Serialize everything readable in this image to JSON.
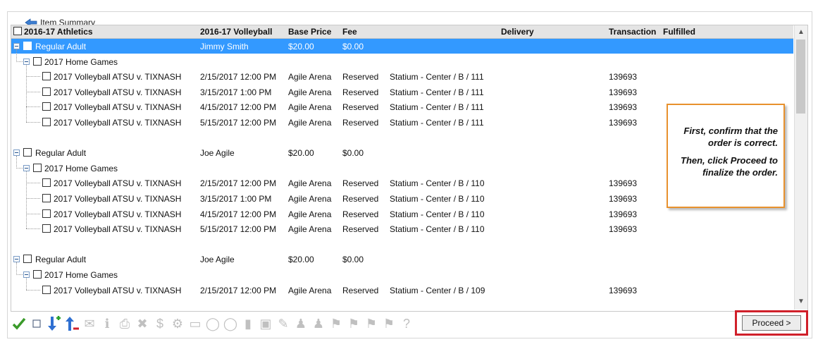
{
  "panel": {
    "title": "Item Summary"
  },
  "columns": {
    "event": "2016-17 Athletics",
    "patron": "2016-17 Volleyball",
    "base_price": "Base Price",
    "fee": "Fee",
    "delivery": "Delivery",
    "transaction": "Transaction",
    "fulfilled": "Fulfilled"
  },
  "groups": [
    {
      "label": "Regular Adult",
      "patron": "Jimmy Smith",
      "price": "$20.00",
      "fee": "$0.00",
      "selected": true,
      "subgroup": "2017 Home Games",
      "items": [
        {
          "name": "2017 Volleyball ATSU v. TIXNASH",
          "date": "2/15/2017 12:00 PM",
          "venue": "Agile Arena",
          "type": "Reserved",
          "seat": "Statium - Center / B / 111",
          "transaction": "139693"
        },
        {
          "name": "2017 Volleyball ATSU v. TIXNASH",
          "date": "3/15/2017 1:00 PM",
          "venue": "Agile Arena",
          "type": "Reserved",
          "seat": "Statium - Center / B / 111",
          "transaction": "139693"
        },
        {
          "name": "2017 Volleyball ATSU v. TIXNASH",
          "date": "4/15/2017 12:00 PM",
          "venue": "Agile Arena",
          "type": "Reserved",
          "seat": "Statium - Center / B / 111",
          "transaction": "139693"
        },
        {
          "name": "2017 Volleyball ATSU v. TIXNASH",
          "date": "5/15/2017 12:00 PM",
          "venue": "Agile Arena",
          "type": "Reserved",
          "seat": "Statium - Center / B / 111",
          "transaction": "139693"
        }
      ]
    },
    {
      "label": "Regular Adult",
      "patron": "Joe Agile",
      "price": "$20.00",
      "fee": "$0.00",
      "selected": false,
      "subgroup": "2017 Home Games",
      "items": [
        {
          "name": "2017 Volleyball ATSU v. TIXNASH",
          "date": "2/15/2017 12:00 PM",
          "venue": "Agile Arena",
          "type": "Reserved",
          "seat": "Statium - Center / B / 110",
          "transaction": "139693"
        },
        {
          "name": "2017 Volleyball ATSU v. TIXNASH",
          "date": "3/15/2017 1:00 PM",
          "venue": "Agile Arena",
          "type": "Reserved",
          "seat": "Statium - Center / B / 110",
          "transaction": "139693"
        },
        {
          "name": "2017 Volleyball ATSU v. TIXNASH",
          "date": "4/15/2017 12:00 PM",
          "venue": "Agile Arena",
          "type": "Reserved",
          "seat": "Statium - Center / B / 110",
          "transaction": "139693"
        },
        {
          "name": "2017 Volleyball ATSU v. TIXNASH",
          "date": "5/15/2017 12:00 PM",
          "venue": "Agile Arena",
          "type": "Reserved",
          "seat": "Statium - Center / B / 110",
          "transaction": "139693"
        }
      ]
    },
    {
      "label": "Regular Adult",
      "patron": "Joe Agile",
      "price": "$20.00",
      "fee": "$0.00",
      "selected": false,
      "subgroup": "2017 Home Games",
      "items": [
        {
          "name": "2017 Volleyball ATSU v. TIXNASH",
          "date": "2/15/2017 12:00 PM",
          "venue": "Agile Arena",
          "type": "Reserved",
          "seat": "Statium - Center / B / 109",
          "transaction": "139693"
        }
      ]
    }
  ],
  "callout": {
    "line1": "First, confirm that the order is correct.",
    "line2": "Then, click Proceed to finalize the order."
  },
  "toolbar": {
    "icons": [
      "check-all-icon",
      "uncheck-all-icon",
      "move-down-icon",
      "move-up-icon",
      "mail-icon",
      "info-icon",
      "print-icon",
      "delete-icon",
      "price-icon",
      "payment-icon",
      "card-icon",
      "ticket-icon",
      "ticket-remove-icon",
      "barcode-icon",
      "document-icon",
      "note-icon",
      "patron-icon",
      "patron-edit-icon",
      "tag-icon",
      "tag-edit-icon",
      "tag-remove-icon",
      "tag-add-icon",
      "help-icon"
    ]
  },
  "proceed_label": "Proceed >"
}
